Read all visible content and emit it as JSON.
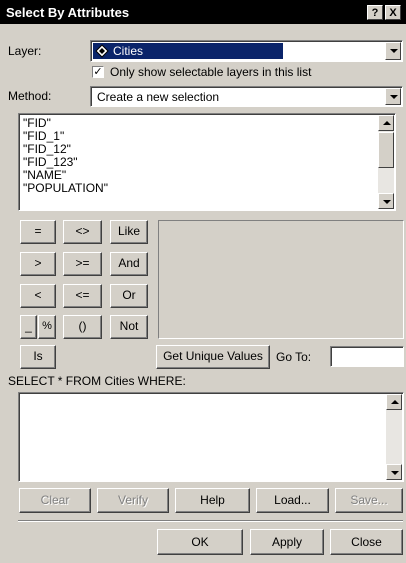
{
  "window": {
    "title": "Select By Attributes",
    "help_button": "?",
    "close_button": "X"
  },
  "layer": {
    "label": "Layer:",
    "value": "Cities",
    "icon": "layer-diamond-icon"
  },
  "only_selectable": {
    "label": "Only show selectable layers in this list",
    "checked": true,
    "mark": "✓"
  },
  "method": {
    "label": "Method:",
    "value": "Create a new selection"
  },
  "fields": [
    "\"FID\"",
    "\"FID_1\"",
    "\"FID_12\"",
    "\"FID_123\"",
    "\"NAME\"",
    "\"POPULATION\""
  ],
  "operators": {
    "eq": "=",
    "ne": "<>",
    "like": "Like",
    "gt": ">",
    "ge": ">=",
    "and": "And",
    "lt": "<",
    "le": "<=",
    "or": "Or",
    "underscore": "_",
    "percent": "%",
    "parens": "()",
    "not": "Not",
    "is": "Is"
  },
  "values": {
    "get_unique_label": "Get Unique Values",
    "goto_label": "Go To:",
    "goto_value": ""
  },
  "query": {
    "label": "SELECT * FROM Cities WHERE:",
    "text": ""
  },
  "buttons": {
    "clear": "Clear",
    "verify": "Verify",
    "help": "Help",
    "load": "Load...",
    "save": "Save...",
    "ok": "OK",
    "apply": "Apply",
    "close": "Close"
  }
}
